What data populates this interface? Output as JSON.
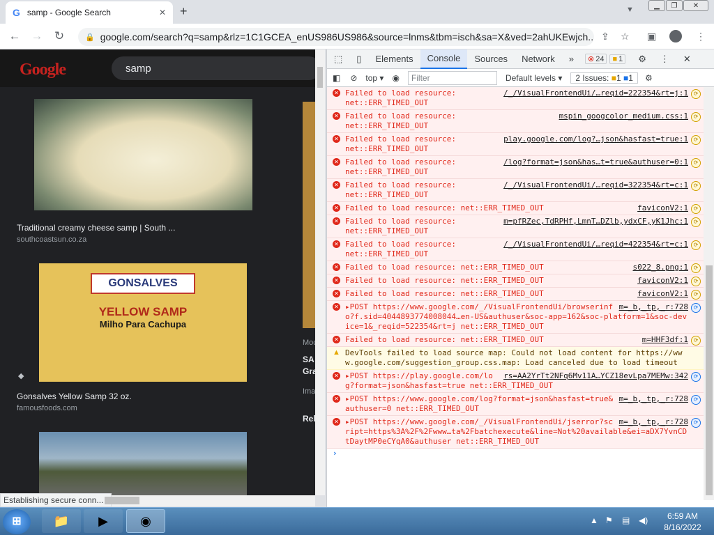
{
  "browser": {
    "tab_title": "samp - Google Search",
    "tab_favicon": "G",
    "close_tab": "✕",
    "new_tab": "+",
    "url": "google.com/search?q=samp&rlz=1C1GCEA_enUS986US986&source=lnms&tbm=isch&sa=X&ved=2ahUKEwjch..."
  },
  "page": {
    "search_query": "samp",
    "results": [
      {
        "title": "Traditional creamy cheese samp | South ...",
        "source": "southcoastsun.co.za"
      },
      {
        "title": "Gonsalves Yellow Samp 32 oz.",
        "source": "famousfoods.com"
      }
    ],
    "right_col": {
      "moc": "Moc",
      "sa": "SA",
      "gra": "Gra",
      "ima": "Ima",
      "rel": "Rel"
    },
    "status_text": "Establishing secure conn..."
  },
  "devtools": {
    "tabs": [
      "Elements",
      "Console",
      "Sources",
      "Network"
    ],
    "more_tabs": "»",
    "error_count": "24",
    "warning_count": "1",
    "context": "top",
    "filter_placeholder": "Filter",
    "levels": "Default levels",
    "issues_label": "2 Issues:",
    "issues_warn": "1",
    "issues_info": "1",
    "prompt": "›",
    "messages": [
      {
        "type": "error",
        "text": "Failed to load resource:\nnet::ERR_TIMED_OUT",
        "source": "/_/VisualFrontendUi/…reqid=222354&rt=j:1",
        "sm": "yellow"
      },
      {
        "type": "error",
        "text": "Failed to load resource:\nnet::ERR_TIMED_OUT",
        "source": "mspin_googcolor_medium.css:1",
        "sm": "yellow"
      },
      {
        "type": "error",
        "text": "Failed to load resource:\nnet::ERR_TIMED_OUT",
        "source": "play.google.com/log?…json&hasfast=true:1",
        "sm": "yellow"
      },
      {
        "type": "error",
        "text": "Failed to load resource:\nnet::ERR_TIMED_OUT",
        "source": "/log?format=json&has…t=true&authuser=0:1",
        "sm": "yellow"
      },
      {
        "type": "error",
        "text": "Failed to load resource:\nnet::ERR_TIMED_OUT",
        "source": "/_/VisualFrontendUi/…reqid=322354&rt=c:1",
        "sm": "yellow"
      },
      {
        "type": "error",
        "text": "Failed to load resource: net::ERR_TIMED_OUT",
        "source": "faviconV2:1",
        "sm": "yellow"
      },
      {
        "type": "error",
        "text": "Failed to load resource:\nnet::ERR_TIMED_OUT",
        "source": "m=pfRZec,TdRPHf,LmnT…DZlb,ydxCF,yK1Jhc:1",
        "sm": "yellow"
      },
      {
        "type": "error",
        "text": "Failed to load resource:\nnet::ERR_TIMED_OUT",
        "source": "/_/VisualFrontendUi/…reqid=422354&rt=c:1",
        "sm": "yellow"
      },
      {
        "type": "error",
        "text": "Failed to load resource: net::ERR_TIMED_OUT",
        "source": "s022_8.png:1",
        "sm": "yellow"
      },
      {
        "type": "error",
        "text": "Failed to load resource: net::ERR_TIMED_OUT",
        "source": "faviconV2:1",
        "sm": "yellow"
      },
      {
        "type": "error",
        "text": "Failed to load resource: net::ERR_TIMED_OUT",
        "source": "faviconV2:1",
        "sm": "yellow"
      },
      {
        "type": "error",
        "text": "▸POST https://www.google.com/_/VisualFrontendUi/browserinfo?f.sid=4044893774008044…en-US&authuser&soc-app=162&soc-platform=1&soc-device=1&_reqid=522354&rt=j net::ERR_TIMED_OUT",
        "source": "m=_b,_tp,_r:728",
        "sm": "blue"
      },
      {
        "type": "error",
        "text": "Failed to load resource: net::ERR_TIMED_OUT",
        "source": "m=HHF3df:1",
        "sm": "yellow"
      },
      {
        "type": "warn",
        "text": "DevTools failed to load source map: Could not load content for https://www.google.com/suggestion_group.css.map: Load canceled due to load timeout",
        "source": "",
        "sm": ""
      },
      {
        "type": "error",
        "text": "▸POST https://play.google.com/log?format=json&hasfast=true net::ERR_TIMED_OUT",
        "source": "rs=AA2YrTt2NFq6Mv11A…YCZ18evLpa7MEMw:342",
        "sm": "blue"
      },
      {
        "type": "error",
        "text": "▸POST https://www.google.com/log?format=json&hasfast=true&authuser=0 net::ERR_TIMED_OUT",
        "source": "m=_b,_tp,_r:728",
        "sm": "blue"
      },
      {
        "type": "error",
        "text": "▸POST https://www.google.com/_/VisualFrontendUi/jserror?script=https%3A%2F%2Fwww…ta%2Fbatchexecute&line=Not%20available&ei=aDX7YvnCDtDaytMP0eCYqA0&authuser net::ERR_TIMED_OUT",
        "source": "m=_b,_tp,_r:728",
        "sm": "blue"
      }
    ]
  },
  "taskbar": {
    "start": "⊞",
    "time": "6:59 AM",
    "date": "8/16/2022"
  }
}
